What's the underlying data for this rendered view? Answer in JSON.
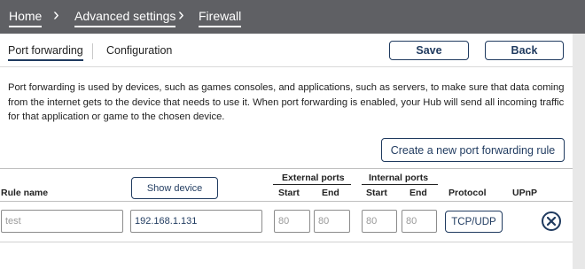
{
  "breadcrumb": {
    "home": "Home",
    "advanced": "Advanced settings",
    "current": "Firewall",
    "separator": "›"
  },
  "tabs": {
    "port_forwarding": "Port forwarding",
    "configuration": "Configuration"
  },
  "actions": {
    "save": "Save",
    "back": "Back",
    "create_rule": "Create a new port forwarding rule"
  },
  "description": "Port forwarding is used by devices, such as games consoles, and applications, such as servers, to make sure that data coming from the internet gets to the device that needs to use it. When port forwarding is enabled, your Hub will send all incoming traffic for that application or game to the chosen device.",
  "table": {
    "headers": {
      "rule_name": "Rule name",
      "show_device": "Show device",
      "external_ports": "External ports",
      "internal_ports": "Internal ports",
      "start": "Start",
      "end": "End",
      "protocol": "Protocol",
      "upnp": "UPnP"
    },
    "rows": [
      {
        "rule_name": "test",
        "device": "192.168.1.131",
        "external_start": "80",
        "external_end": "80",
        "internal_start": "80",
        "internal_end": "80",
        "protocol": "TCP/UDP",
        "remove_icon": "close-circle-icon"
      }
    ]
  },
  "colors": {
    "accent": "#1f3a5f",
    "topbar": "#5f6064",
    "background": "#f2f2f2"
  }
}
